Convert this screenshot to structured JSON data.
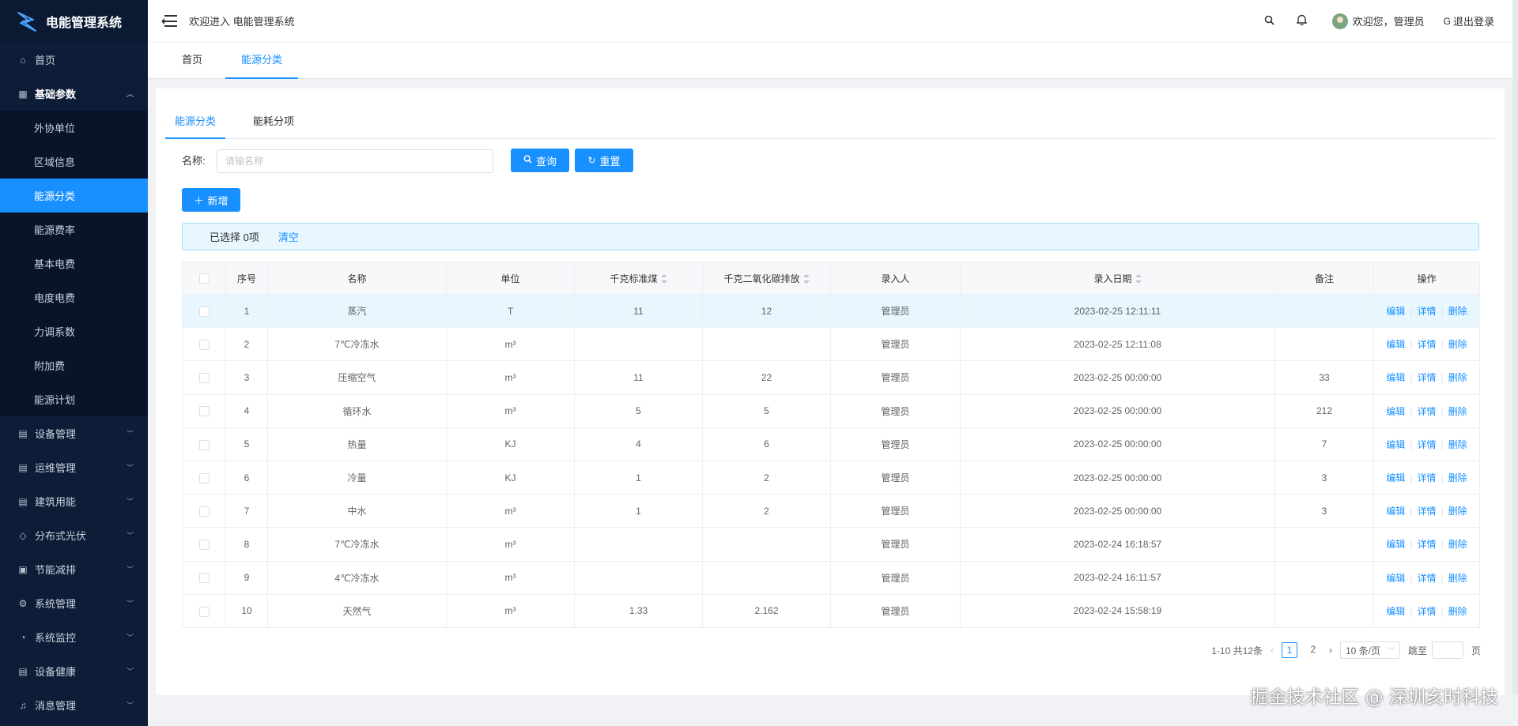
{
  "app": {
    "title": "电能管理系统"
  },
  "header": {
    "welcome": "欢迎进入 电能管理系统",
    "search_icon": "search-icon",
    "bell_icon": "bell-icon",
    "user_text": "欢迎您，管理员",
    "logout": "退出登录"
  },
  "sidebar": {
    "home": "首页",
    "basic": "基础参数",
    "sub": [
      "外协单位",
      "区域信息",
      "能源分类",
      "能源费率",
      "基本电费",
      "电度电费",
      "力调系数",
      "附加费",
      "能源计划"
    ],
    "groups": [
      "设备管理",
      "运维管理",
      "建筑用能",
      "分布式光伏",
      "节能减排",
      "系统管理",
      "系统监控",
      "设备健康",
      "消息管理"
    ]
  },
  "top_tabs": [
    "首页",
    "能源分类"
  ],
  "inner_tabs": [
    "能源分类",
    "能耗分项"
  ],
  "search": {
    "label": "名称:",
    "placeholder": "请输名称",
    "query": "查询",
    "reset": "重置",
    "add": "新增"
  },
  "selection": {
    "text": "已选择 0项",
    "clear": "清空"
  },
  "table": {
    "headers": [
      "序号",
      "名称",
      "单位",
      "千克标准煤",
      "千克二氧化碳排放",
      "录入人",
      "录入日期",
      "备注",
      "操作"
    ],
    "ops": [
      "编辑",
      "详情",
      "删除"
    ],
    "rows": [
      [
        "1",
        "蒸汽",
        "T",
        "11",
        "12",
        "管理员",
        "2023-02-25 12:11:11",
        ""
      ],
      [
        "2",
        "7℃冷冻水",
        "m³",
        "",
        "",
        "管理员",
        "2023-02-25 12:11:08",
        ""
      ],
      [
        "3",
        "压缩空气",
        "m³",
        "11",
        "22",
        "管理员",
        "2023-02-25 00:00:00",
        "33"
      ],
      [
        "4",
        "循环水",
        "m³",
        "5",
        "5",
        "管理员",
        "2023-02-25 00:00:00",
        "212"
      ],
      [
        "5",
        "热量",
        "KJ",
        "4",
        "6",
        "管理员",
        "2023-02-25 00:00:00",
        "7"
      ],
      [
        "6",
        "冷量",
        "KJ",
        "1",
        "2",
        "管理员",
        "2023-02-25 00:00:00",
        "3"
      ],
      [
        "7",
        "中水",
        "m³",
        "1",
        "2",
        "管理员",
        "2023-02-25 00:00:00",
        "3"
      ],
      [
        "8",
        "7℃冷冻水",
        "m³",
        "",
        "",
        "管理员",
        "2023-02-24 16:18:57",
        ""
      ],
      [
        "9",
        "4℃冷冻水",
        "m³",
        "",
        "",
        "管理员",
        "2023-02-24 16:11:57",
        ""
      ],
      [
        "10",
        "天然气",
        "m³",
        "1.33",
        "2.162",
        "管理员",
        "2023-02-24 15:58:19",
        ""
      ]
    ]
  },
  "pagination": {
    "total": "1-10 共12条",
    "pages": [
      "1",
      "2"
    ],
    "size": "10 条/页",
    "jump": "跳至",
    "page_suffix": "页"
  },
  "watermark": "掘金技术社区 @ 深圳亥时科技",
  "colors": {
    "primary": "#1890ff",
    "sidebar": "#0d1d38",
    "sidebar_active": "#1890ff"
  }
}
